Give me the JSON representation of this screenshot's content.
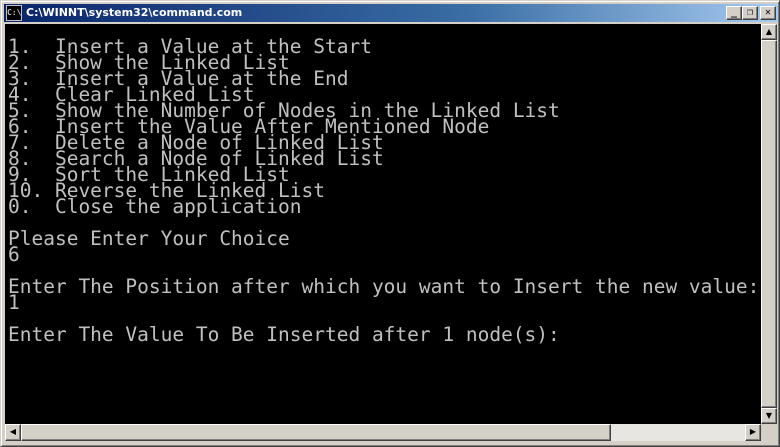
{
  "window": {
    "title": "C:\\WINNT\\system32\\command.com",
    "icon_label": "C:\\",
    "buttons": {
      "minimize": "_",
      "restore": "❐",
      "close": "✕"
    }
  },
  "console": {
    "lines": [
      "1.  Insert a Value at the Start",
      "2.  Show the Linked List",
      "3.  Insert a Value at the End",
      "4.  Clear Linked List",
      "5.  Show the Number of Nodes in the Linked List",
      "6.  Insert the Value After Mentioned Node",
      "7.  Delete a Node of Linked List",
      "8.  Search a Node of Linked List",
      "9.  Sort the Linked List",
      "10. Reverse the Linked List",
      "0.  Close the application",
      "",
      "Please Enter Your Choice",
      "6",
      "",
      "Enter The Position after which you want to Insert the new value:",
      "1",
      "",
      "Enter The Value To Be Inserted after 1 node(s):"
    ]
  },
  "scrollbars": {
    "up": "▲",
    "down": "▼",
    "left": "◀",
    "right": "▶"
  },
  "colors": {
    "console_bg": "#000000",
    "console_fg": "#c0c0c0",
    "titlebar_start": "#0a246a",
    "titlebar_end": "#a6caf0"
  }
}
